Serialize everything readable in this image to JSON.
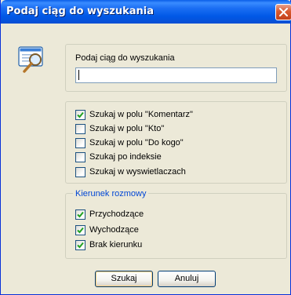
{
  "window": {
    "title": "Podaj ciąg do wyszukania",
    "close_icon": "close-icon"
  },
  "search": {
    "label": "Podaj ciąg do wyszukania",
    "value": "",
    "icon": "search-magnifier-icon"
  },
  "options": [
    {
      "label": "Szukaj w polu \"Komentarz\"",
      "checked": true
    },
    {
      "label": "Szukaj w polu \"Kto\"",
      "checked": false
    },
    {
      "label": "Szukaj w polu \"Do kogo\"",
      "checked": false
    },
    {
      "label": "Szukaj po indeksie",
      "checked": false
    },
    {
      "label": "Szukaj w wyswietlaczach",
      "checked": false
    }
  ],
  "direction": {
    "legend": "Kierunek rozmowy",
    "items": [
      {
        "label": "Przychodzące",
        "checked": true
      },
      {
        "label": "Wychodzące",
        "checked": true
      },
      {
        "label": "Brak kierunku",
        "checked": true
      }
    ]
  },
  "buttons": {
    "ok": "Szukaj",
    "cancel": "Anuluj"
  },
  "colors": {
    "titlebar": "#0058e6",
    "dialog_bg": "#ece9d8",
    "legend_text": "#0046d5",
    "checkmark": "#21a121",
    "close_button": "#d9592e"
  }
}
